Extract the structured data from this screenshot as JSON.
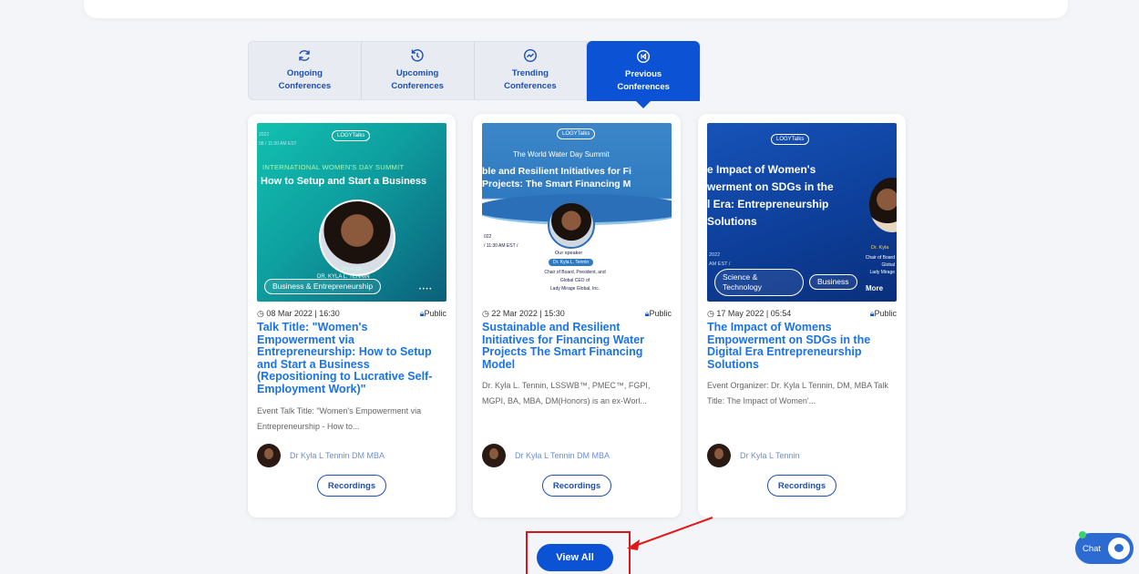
{
  "tabs": [
    {
      "label": "Ongoing\nConferences",
      "icon": "refresh-icon"
    },
    {
      "label": "Upcoming\nConferences",
      "icon": "history-icon"
    },
    {
      "label": "Trending\nConferences",
      "icon": "trending-icon"
    },
    {
      "label": "Previous\nConferences",
      "icon": "previous-icon"
    }
  ],
  "cards": [
    {
      "thumb": {
        "brand": "LOGYTalks",
        "kicker": "INTERNATIONAL WOMEN'S DAY SUMMIT",
        "headline": "How to Setup and Start a Business",
        "date_fragment": "2022",
        "time_fragment": "08 / 11:30 AM EST",
        "speaker_role": "SPEAKER",
        "speaker_name": "DR. KYLA L. TENNIN",
        "category": "Business & Entrepreneurship",
        "more": "• • • •"
      },
      "date": "08 Mar 2022 | 16:30",
      "visibility": "Public",
      "title": "Talk Title: \"Women's Empowerment via Entrepreneurship: How to Setup and Start a Business (Repositioning to Lucrative Self-Employment Work)\"",
      "desc": "Event Talk Title: \"Women's Empowerment via Entrepreneurship - How to...",
      "speaker": "Dr Kyla L Tennin DM MBA",
      "button": "Recordings"
    },
    {
      "thumb": {
        "brand": "LOGYTalks",
        "kicker": "The World Water Day Summit",
        "headline": "ble and Resilient Initiatives for Fi\nProjects: The Smart Financing M",
        "date_fragment": "022",
        "time_fragment": "/ 11:30 AM EST /",
        "speaker_role": "Our speaker",
        "speaker_name": "Dr. Kyla L. Tennin",
        "speaker_bio": "Chair of Board, President, and\nGlobal CEO of\nLady Mirage Global, Inc."
      },
      "date": "22 Mar 2022 | 15:30",
      "visibility": "Public",
      "title": "Sustainable and Resilient Initiatives for Financing Water Projects The Smart Financing Model",
      "desc": "Dr. Kyla L. Tennin, LSSWB™, PMEC™, FGPI, MGPI, BA, MBA, DM(Honors) is an ex-Worl...",
      "speaker": "Dr Kyla L Tennin DM MBA",
      "button": "Recordings"
    },
    {
      "thumb": {
        "brand": "LOGYTalks",
        "headline": "e Impact of Women's\nwerment on SDGs in the\nl Era: Entrepreneurship\nSolutions",
        "date_fragment": "2022",
        "time_fragment": "AM EST /",
        "speaker_name": "Dr. Kyla",
        "speaker_bio": "Chair of Board\nGlobal\nLady Mirage",
        "cat1": "Science &\nTechnology",
        "cat2": "Business",
        "more": "More"
      },
      "date": "17 May 2022 | 05:54",
      "visibility": "Public",
      "title": "The Impact of Womens Empowerment on SDGs in the Digital Era Entrepreneurship Solutions",
      "desc": "Event Organizer: Dr. Kyla L Tennin, DM, MBA Talk Title: The Impact of Women'...",
      "speaker": "Dr Kyla L Tennin",
      "button": "Recordings"
    }
  ],
  "view_all": "View All",
  "chat": "Chat"
}
